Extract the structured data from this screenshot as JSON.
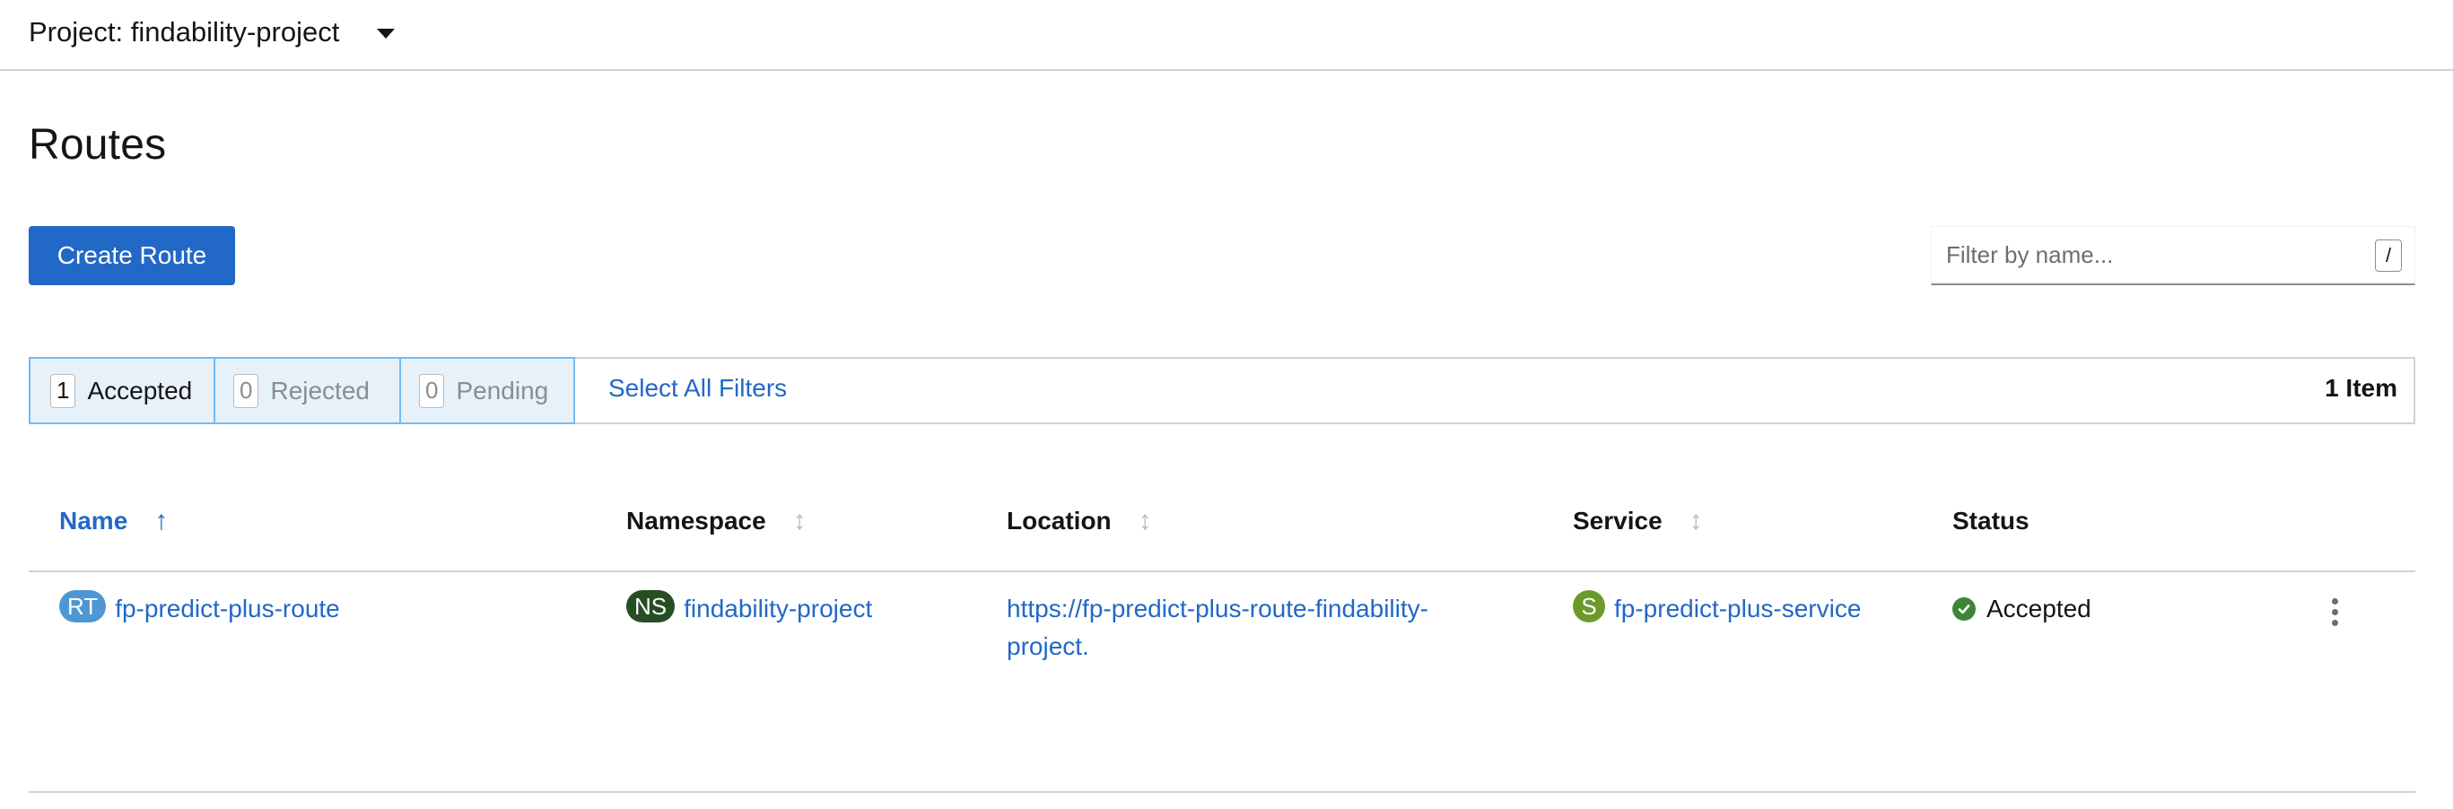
{
  "project_bar": {
    "label": "Project: findability-project"
  },
  "page": {
    "title": "Routes"
  },
  "toolbar": {
    "create_button": "Create Route",
    "filter_placeholder": "Filter by name...",
    "filter_shortcut": "/"
  },
  "row_filters": {
    "accepted": {
      "count": "1",
      "label": "Accepted",
      "selected": true
    },
    "rejected": {
      "count": "0",
      "label": "Rejected",
      "selected": false
    },
    "pending": {
      "count": "0",
      "label": "Pending",
      "selected": false
    },
    "select_all": "Select All Filters",
    "item_count": "1 Item"
  },
  "table": {
    "columns": {
      "name": "Name",
      "namespace": "Namespace",
      "location": "Location",
      "service": "Service",
      "status": "Status"
    },
    "sort": {
      "column": "name",
      "direction": "ascending"
    },
    "rows": [
      {
        "name_badge": "RT",
        "name": "fp-predict-plus-route",
        "namespace_badge": "NS",
        "namespace": "findability-project",
        "location": "https://fp-predict-plus-route-findability-project.",
        "service_badge": "S",
        "service": "fp-predict-plus-service",
        "status": "Accepted"
      }
    ]
  },
  "colors": {
    "primary": "#2268c6",
    "badge_route": "#4f96d4",
    "badge_namespace": "#264d24",
    "badge_service": "#6b9a2b",
    "status_success": "#3e8635",
    "filter_selected_bg": "#e7f1fa",
    "filter_selected_border": "#73bcf7"
  },
  "icons": {
    "project_dropdown": "caret-down-icon",
    "sort_active": "long-arrow-up-icon",
    "sort_inactive": "arrows-alt-v-icon",
    "status": "check-circle-icon",
    "row_actions": "kebab-icon"
  }
}
